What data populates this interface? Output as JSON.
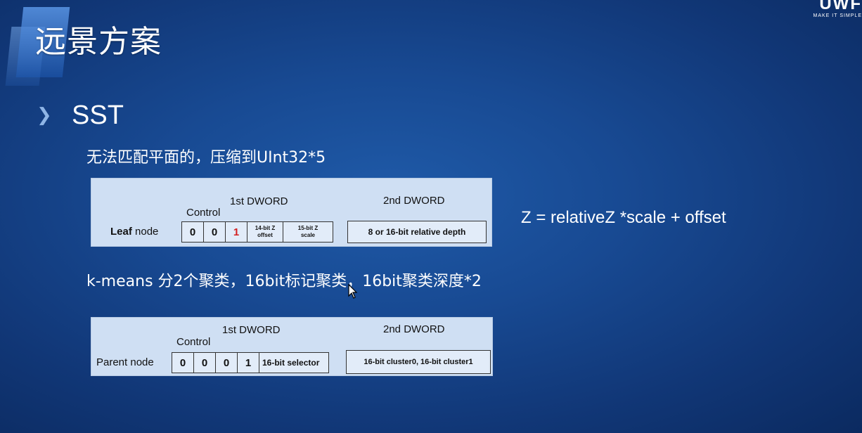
{
  "slide": {
    "title": "远景方案",
    "heading": "SST",
    "line1": "无法匹配平面的，压缩到UInt32*5",
    "line2": "k-means 分2个聚类，16bit标记聚类，16bit聚类深度*2",
    "formula": "Z =  relativeZ *scale + offset"
  },
  "brand": {
    "logo": "UWF",
    "tagline": "MAKE IT SIMPLE"
  },
  "leaf_diagram": {
    "dword1": "1st DWORD",
    "dword2": "2nd DWORD",
    "control": "Control",
    "row_label_bold": "Leaf",
    "row_label_rest": " node",
    "cells": [
      "0",
      "0",
      "1"
    ],
    "offset_line1": "14-bit Z",
    "offset_line2": "offset",
    "scale_line1": "15-bit Z",
    "scale_line2": "scale",
    "depth_box": "8 or 16-bit relative depth"
  },
  "parent_diagram": {
    "dword1": "1st DWORD",
    "dword2": "2nd DWORD",
    "control": "Control",
    "row_label": "Parent node",
    "cells": [
      "0",
      "0",
      "0",
      "1"
    ],
    "selector": "16-bit selector",
    "cluster_box": "16-bit cluster0, 16-bit cluster1"
  },
  "colors": {
    "background": "#184a93",
    "diagram_bg": "#cfdff3",
    "highlight_red": "#d42020"
  },
  "icons": {
    "bullet": "chevron-right-icon",
    "cursor": "mouse-cursor-icon"
  }
}
